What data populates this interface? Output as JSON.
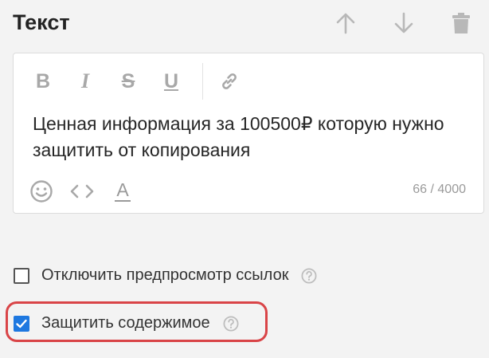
{
  "block": {
    "title": "Текст",
    "actions": {
      "move_up": "arrow-up-icon",
      "move_down": "arrow-down-icon",
      "delete": "trash-icon"
    }
  },
  "toolbar": {
    "bold_label": "B",
    "italic_label": "I",
    "strike_label": "S",
    "underline_label": "U",
    "link_icon": "link-icon"
  },
  "editor": {
    "text": "Ценная информация за 100500₽ которую нужно защитить от копирования",
    "counter": "66 / 4000",
    "bottom_tools": {
      "emoji": "emoji-icon",
      "code": "code-icon",
      "text_color_label": "A"
    }
  },
  "options": [
    {
      "label": "Отключить предпросмотр ссылок",
      "checked": false
    },
    {
      "label": "Защитить содержимое",
      "checked": true
    }
  ],
  "colors": {
    "accent": "#1e78e0",
    "highlight": "#d94447",
    "icon_gray": "#b4b4b4"
  }
}
